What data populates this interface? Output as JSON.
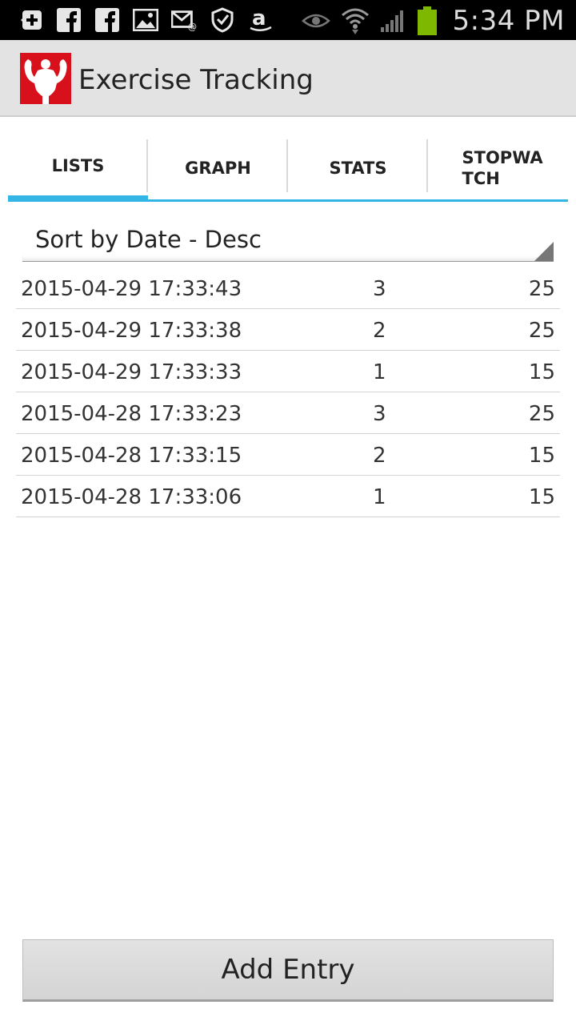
{
  "status_bar": {
    "time": "5:34 PM",
    "left_icons": [
      "add-icon",
      "facebook-icon",
      "facebook-icon",
      "image-icon",
      "email-icon",
      "shield-icon",
      "amazon-icon"
    ],
    "right_icons": [
      "eye-icon",
      "wifi-icon",
      "signal-icon",
      "battery-icon"
    ]
  },
  "app": {
    "title": "Exercise Tracking",
    "brand_color": "#d8101c"
  },
  "tabs": [
    {
      "label": "LISTS",
      "active": true
    },
    {
      "label": "GRAPH",
      "active": false
    },
    {
      "label": "STATS",
      "active": false
    },
    {
      "label": "STOPWA TCH",
      "active": false
    }
  ],
  "accent_color": "#33b5e5",
  "sort": {
    "selected": "Sort by Date - Desc"
  },
  "entries": [
    {
      "date": "2015-04-29 17:33:43",
      "set": "3",
      "value": "25"
    },
    {
      "date": "2015-04-29 17:33:38",
      "set": "2",
      "value": "25"
    },
    {
      "date": "2015-04-29 17:33:33",
      "set": "1",
      "value": "15"
    },
    {
      "date": "2015-04-28 17:33:23",
      "set": "3",
      "value": "25"
    },
    {
      "date": "2015-04-28 17:33:15",
      "set": "2",
      "value": "15"
    },
    {
      "date": "2015-04-28 17:33:06",
      "set": "1",
      "value": "15"
    }
  ],
  "add_button": {
    "label": "Add Entry"
  }
}
